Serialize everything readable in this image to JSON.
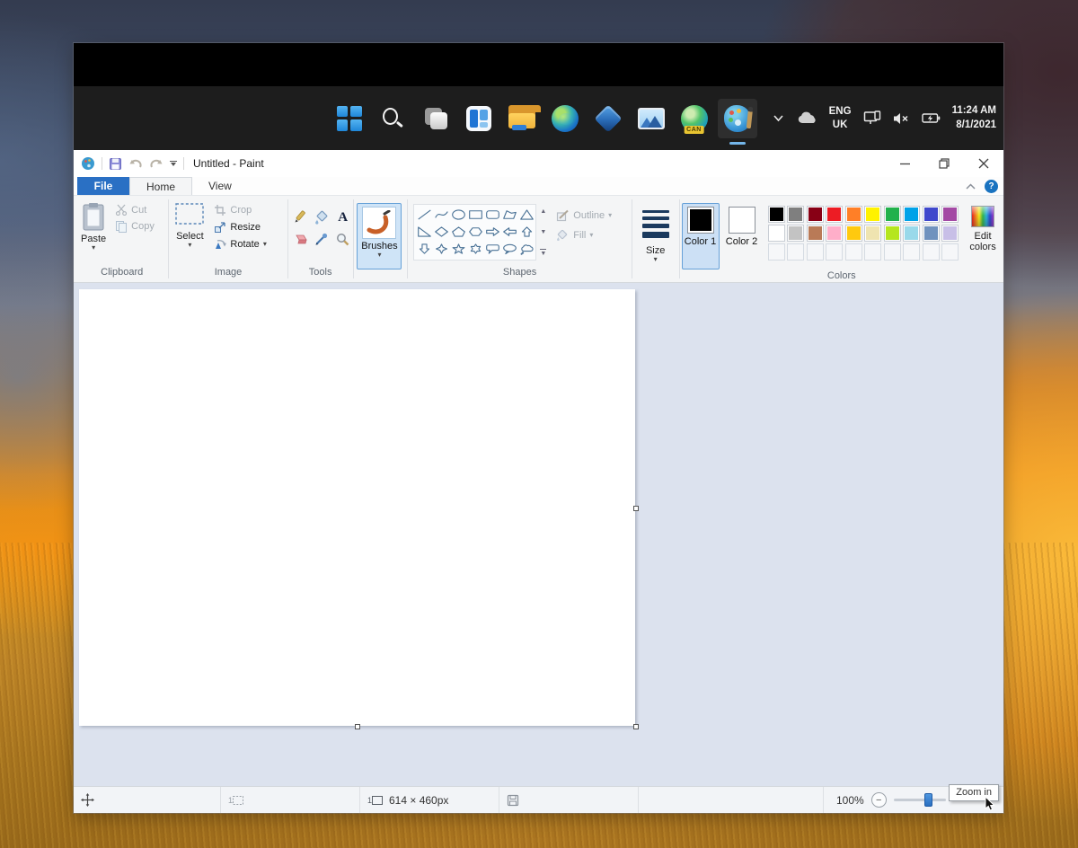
{
  "taskbar": {
    "icons": [
      {
        "name": "start"
      },
      {
        "name": "search"
      },
      {
        "name": "task-view"
      },
      {
        "name": "widgets"
      },
      {
        "name": "file-explorer"
      },
      {
        "name": "edge"
      },
      {
        "name": "store-cube"
      },
      {
        "name": "photos"
      },
      {
        "name": "edge-canary",
        "badge": "CAN"
      },
      {
        "name": "paint",
        "active": true
      }
    ],
    "tray": {
      "language_line1": "ENG",
      "language_line2": "UK",
      "time": "11:24 AM",
      "date": "8/1/2021"
    }
  },
  "window": {
    "title": "Untitled - Paint",
    "tabs": [
      {
        "label": "File"
      },
      {
        "label": "Home"
      },
      {
        "label": "View"
      }
    ],
    "help_glyph": "?"
  },
  "ribbon": {
    "clipboard": {
      "label": "Clipboard",
      "paste": "Paste",
      "cut": "Cut",
      "copy": "Copy"
    },
    "image": {
      "label": "Image",
      "select": "Select",
      "crop": "Crop",
      "resize": "Resize",
      "rotate": "Rotate"
    },
    "tools": {
      "label": "Tools",
      "items": [
        "pencil",
        "fill-with-color",
        "text",
        "eraser",
        "color-picker",
        "magnifier"
      ]
    },
    "brushes": {
      "label": "Brushes"
    },
    "shapes": {
      "label": "Shapes",
      "outline": "Outline",
      "fill": "Fill",
      "items": [
        "line",
        "curve",
        "ellipse",
        "rectangle",
        "rounded-rectangle",
        "polygon",
        "triangle",
        "right-triangle",
        "diamond",
        "pentagon",
        "hexagon",
        "right-arrow",
        "left-arrow",
        "up-arrow",
        "down-arrow",
        "four-point-star",
        "five-point-star",
        "six-point-star",
        "rounded-rectangular-callout",
        "oval-callout",
        "cloud-callout"
      ]
    },
    "size": {
      "label": "Size"
    },
    "colors": {
      "label": "Colors",
      "color1_label": "Color 1",
      "color2_label": "Color 2",
      "color1_value": "#000000",
      "color2_value": "#ffffff",
      "edit_label": "Edit colors",
      "row1": [
        "#000000",
        "#7f7f7f",
        "#880015",
        "#ed1c24",
        "#ff7f27",
        "#fff200",
        "#22b14c",
        "#00a2e8",
        "#3f48cc",
        "#a349a4"
      ],
      "row2": [
        "#ffffff",
        "#c3c3c3",
        "#b97a57",
        "#ffaec9",
        "#ffc90e",
        "#efe4b0",
        "#b5e61d",
        "#99d9ea",
        "#7092be",
        "#c8bfe7"
      ],
      "empty_count": 10
    }
  },
  "statusbar": {
    "canvas_size": "614 × 460px",
    "zoom_level": "100%",
    "zoom_tooltip": "Zoom in"
  }
}
